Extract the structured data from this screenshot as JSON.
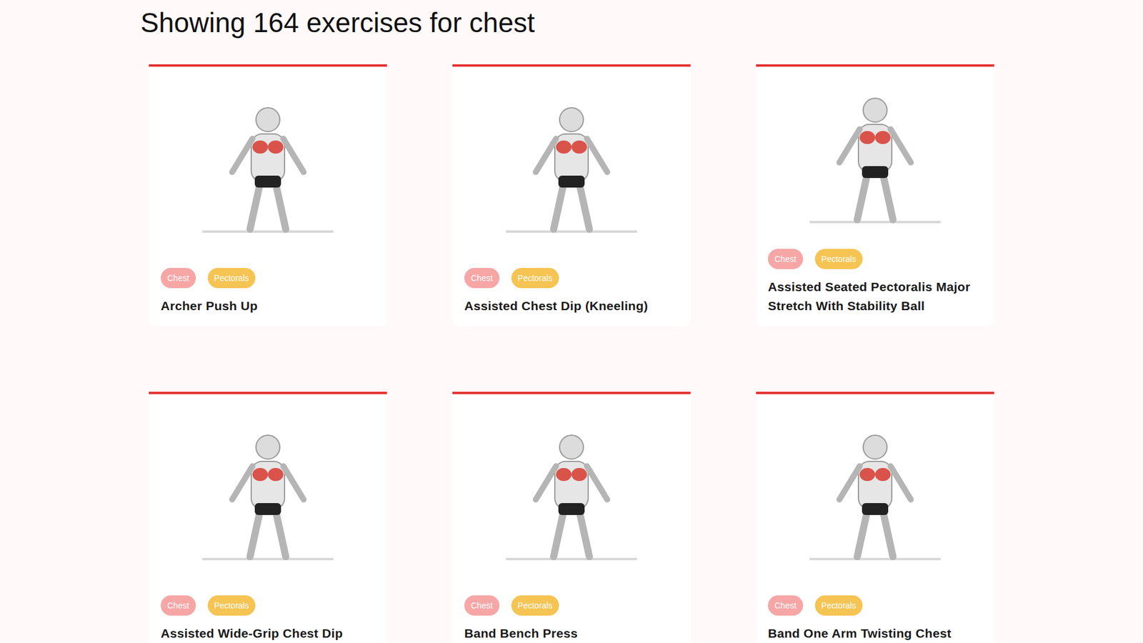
{
  "heading": "Showing 164 exercises for chest",
  "exercises": [
    {
      "title": "Archer Push Up",
      "tags": [
        {
          "label": "Chest",
          "color": "#f7a6a6"
        },
        {
          "label": "Pectorals",
          "color": "#f6c453"
        }
      ]
    },
    {
      "title": "Assisted Chest Dip (Kneeling)",
      "tags": [
        {
          "label": "Chest",
          "color": "#f7a6a6"
        },
        {
          "label": "Pectorals",
          "color": "#f6c453"
        }
      ]
    },
    {
      "title": "Assisted Seated Pectoralis Major Stretch With Stability Ball",
      "tags": [
        {
          "label": "Chest",
          "color": "#f7a6a6"
        },
        {
          "label": "Pectorals",
          "color": "#f6c453"
        }
      ]
    },
    {
      "title": "Assisted Wide-Grip Chest Dip",
      "tags": [
        {
          "label": "Chest",
          "color": "#f7a6a6"
        },
        {
          "label": "Pectorals",
          "color": "#f6c453"
        }
      ]
    },
    {
      "title": "Band Bench Press",
      "tags": [
        {
          "label": "Chest",
          "color": "#f7a6a6"
        },
        {
          "label": "Pectorals",
          "color": "#f6c453"
        }
      ]
    },
    {
      "title": "Band One Arm Twisting Chest",
      "tags": [
        {
          "label": "Chest",
          "color": "#f7a6a6"
        },
        {
          "label": "Pectorals",
          "color": "#f6c453"
        }
      ]
    }
  ]
}
